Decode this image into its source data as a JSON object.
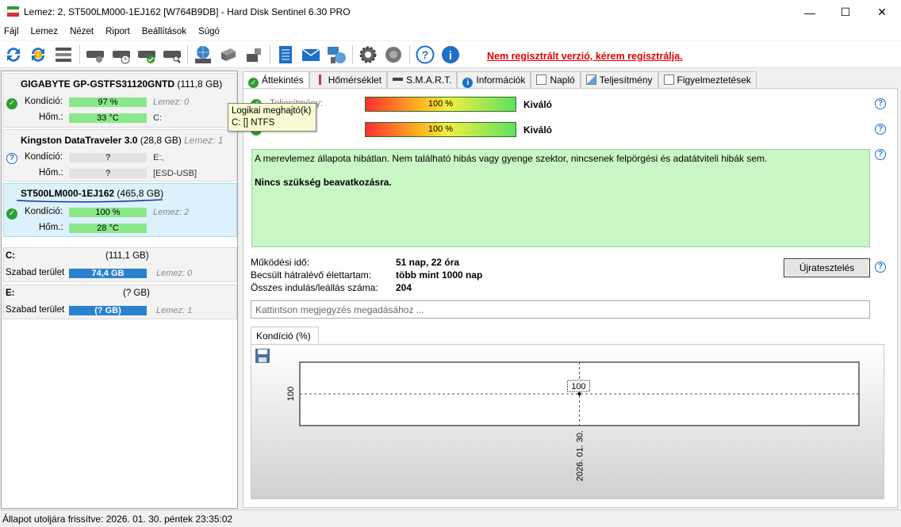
{
  "window": {
    "title": "Lemez: 2, ST500LM000-1EJ162 [W764B9DB]  -  Hard Disk Sentinel 6.30 PRO",
    "minimize": "—",
    "maximize": "☐",
    "close": "✕"
  },
  "menu": [
    "Fájl",
    "Lemez",
    "Nézet",
    "Riport",
    "Beállítások",
    "Súgó"
  ],
  "toolbar": {
    "unregistered_text": "Nem regisztrált verzió, kérem regisztrálja.",
    "icons": [
      "refresh-icon",
      "refresh-warning-icon",
      "disk-list-icon",
      "disk-scan-icon",
      "disk-clock-icon",
      "disk-check-icon",
      "disk-search-icon",
      "network-disk-icon",
      "drive-icon",
      "usb-drive-icon",
      "report-icon",
      "email-icon",
      "network-icon",
      "settings-icon",
      "sound-icon",
      "help-icon",
      "info-icon"
    ]
  },
  "disks": [
    {
      "name": "GIGABYTE GP-GSTFS31120GNTD",
      "size": "(111,8 GB)",
      "health_label": "Kondíció:",
      "health": "97 %",
      "health_level": 0.97,
      "temp_label": "Hőm.:",
      "temp": "33 °C",
      "side1": "Lemez: 0",
      "side2": "C:",
      "status": "ok"
    },
    {
      "name": "Kingston DataTraveler 3.0",
      "size": "(28,8 GB)",
      "side0": "Lemez: 1",
      "health_label": "Kondíció:",
      "health": "?",
      "temp_label": "Hőm.:",
      "temp": "?",
      "side1": "E:,",
      "side2": "[ESD-USB]",
      "status": "unknown"
    },
    {
      "name": "ST500LM000-1EJ162",
      "size": "(465,8 GB)",
      "health_label": "Kondíció:",
      "health": "100 %",
      "health_level": 1.0,
      "temp_label": "Hőm.:",
      "temp": "28 °C",
      "side1": "Lemez: 2",
      "status": "ok"
    }
  ],
  "volumes": [
    {
      "letter": "C:",
      "size": "(111,1 GB)",
      "free_label": "Szabad terület",
      "free": "74,4 GB",
      "used_fraction": 0.67,
      "disk": "Lemez: 0"
    },
    {
      "letter": "E:",
      "size": "(? GB)",
      "free_label": "Szabad terület",
      "free": "(? GB)",
      "disk": "Lemez: 1"
    }
  ],
  "tooltip": {
    "line1": "Logikai meghajtó(k)",
    "line2": "C: [] NTFS"
  },
  "tabs": [
    "Áttekintés",
    "Hőmérséklet",
    "S.M.A.R.T.",
    "Információk",
    "Napló",
    "Teljesítmény",
    "Figyelmeztetések"
  ],
  "overview": {
    "performance_label": "Teljesítmény:",
    "performance_value": "100 %",
    "performance_rating": "Kiváló",
    "health_label": "Kondíció:",
    "health_value": "100 %",
    "health_rating": "Kiváló",
    "status_text": "A merevlemez állapota hibátlan. Nem található hibás vagy gyenge szektor, nincsenek felpörgési és adatátviteli hibák sem.",
    "status_action": "Nincs szükség beavatkozásra.",
    "uptime_label": "Működési idő:",
    "uptime": "51 nap, 22 óra",
    "lifetime_label": "Becsült hátralévő élettartam:",
    "lifetime": "több mint 1000 nap",
    "starts_label": "Összes indulás/leállás száma:",
    "starts": "204",
    "retest_button": "Újratesztelés",
    "note_placeholder": "Kattintson megjegyzés megadásához ...",
    "chart_tab": "Kondíció  (%)"
  },
  "chart_data": {
    "type": "line",
    "x": [
      "2026. 01. 30."
    ],
    "values": [
      100
    ],
    "point_labels": [
      "100"
    ],
    "ylabel": "100",
    "title": "Kondíció  (%)"
  },
  "statusbar": "Állapot utoljára frissítve: 2026. 01. 30. péntek 23:35:02"
}
